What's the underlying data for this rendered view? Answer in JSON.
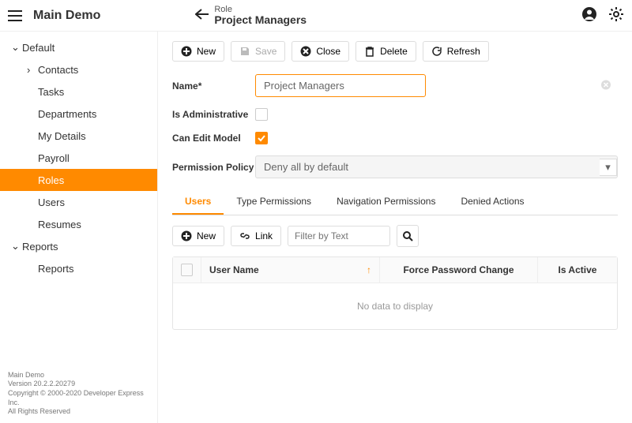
{
  "header": {
    "app_title": "Main Demo",
    "breadcrumb_label": "Role",
    "page_title": "Project Managers"
  },
  "sidebar": {
    "groups": [
      {
        "label": "Default",
        "expanded": true
      },
      {
        "label": "Reports",
        "expanded": true
      }
    ],
    "items": [
      {
        "label": "Contacts",
        "hasChildren": true
      },
      {
        "label": "Tasks"
      },
      {
        "label": "Departments"
      },
      {
        "label": "My Details"
      },
      {
        "label": "Payroll"
      },
      {
        "label": "Roles",
        "active": true
      },
      {
        "label": "Users"
      },
      {
        "label": "Resumes"
      }
    ],
    "reports_items": [
      {
        "label": "Reports"
      }
    ]
  },
  "toolbar": {
    "new": "New",
    "save": "Save",
    "close": "Close",
    "delete": "Delete",
    "refresh": "Refresh"
  },
  "form": {
    "name_label": "Name",
    "name_value": "Project Managers",
    "is_admin_label": "Is Administrative",
    "is_admin_checked": false,
    "can_edit_label": "Can Edit Model",
    "can_edit_checked": true,
    "policy_label": "Permission Policy",
    "policy_value": "Deny all by default"
  },
  "tabs": [
    {
      "label": "Users",
      "active": true
    },
    {
      "label": "Type Permissions"
    },
    {
      "label": "Navigation Permissions"
    },
    {
      "label": "Denied Actions"
    }
  ],
  "list_toolbar": {
    "new": "New",
    "link": "Link",
    "filter_placeholder": "Filter by Text"
  },
  "grid": {
    "columns": {
      "username": "User Name",
      "force": "Force Password Change",
      "active": "Is Active"
    },
    "empty": "No data to display"
  },
  "footer": {
    "line1": "Main Demo",
    "line2": "Version 20.2.2.20279",
    "line3": "Copyright © 2000-2020 Developer Express Inc.",
    "line4": "All Rights Reserved"
  }
}
